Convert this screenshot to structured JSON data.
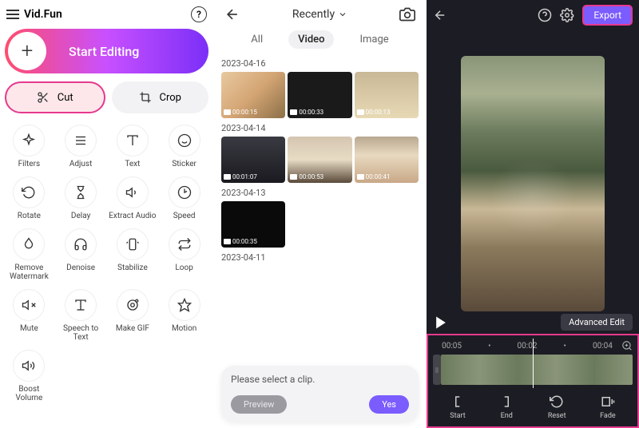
{
  "panel1": {
    "title": "Vid.Fun",
    "start_label": "Start Editing",
    "cut_label": "Cut",
    "crop_label": "Crop",
    "tools": [
      {
        "label": "Filters",
        "icon": "sparkle"
      },
      {
        "label": "Adjust",
        "icon": "sliders"
      },
      {
        "label": "Text",
        "icon": "text"
      },
      {
        "label": "Sticker",
        "icon": "smile"
      },
      {
        "label": "Rotate",
        "icon": "rotate"
      },
      {
        "label": "Delay",
        "icon": "hourglass"
      },
      {
        "label": "Extract Audio",
        "icon": "audio"
      },
      {
        "label": "Speed",
        "icon": "gauge"
      },
      {
        "label": "Remove Watermark",
        "icon": "drop"
      },
      {
        "label": "Denoise",
        "icon": "headphones"
      },
      {
        "label": "Stabilize",
        "icon": "phone-shake"
      },
      {
        "label": "Loop",
        "icon": "loop"
      },
      {
        "label": "Mute",
        "icon": "mute"
      },
      {
        "label": "Speech to Text",
        "icon": "speech"
      },
      {
        "label": "Make GIF",
        "icon": "gif"
      },
      {
        "label": "Motion",
        "icon": "star"
      },
      {
        "label": "Boost Volume",
        "icon": "volume"
      }
    ]
  },
  "panel2": {
    "recently": "Recently",
    "tabs": {
      "all": "All",
      "video": "Video",
      "image": "Image"
    },
    "groups": [
      {
        "date": "2023-04-16",
        "items": [
          {
            "dur": "00:00:15",
            "cls": "scene1"
          },
          {
            "dur": "00:00:33",
            "cls": "scene2"
          },
          {
            "dur": "00:00:13",
            "cls": "scene3"
          }
        ]
      },
      {
        "date": "2023-04-14",
        "items": [
          {
            "dur": "00:01:07",
            "cls": "scene4"
          },
          {
            "dur": "00:00:53",
            "cls": "scene5"
          },
          {
            "dur": "00:00:41",
            "cls": "scene6"
          }
        ]
      },
      {
        "date": "2023-04-13",
        "items": [
          {
            "dur": "00:00:35",
            "cls": "scene7"
          }
        ]
      },
      {
        "date": "2023-04-11",
        "items": []
      }
    ],
    "dialog": {
      "text": "Please select a clip.",
      "preview": "Preview",
      "yes": "Yes"
    }
  },
  "panel3": {
    "export": "Export",
    "advanced": "Advanced Edit",
    "times": [
      "00:05",
      "•",
      "00:02",
      "•",
      "00:04"
    ],
    "tools": [
      {
        "label": "Start",
        "icon": "bracket-l"
      },
      {
        "label": "End",
        "icon": "bracket-r"
      },
      {
        "label": "Reset",
        "icon": "reset"
      },
      {
        "label": "Fade",
        "icon": "fade"
      }
    ]
  }
}
